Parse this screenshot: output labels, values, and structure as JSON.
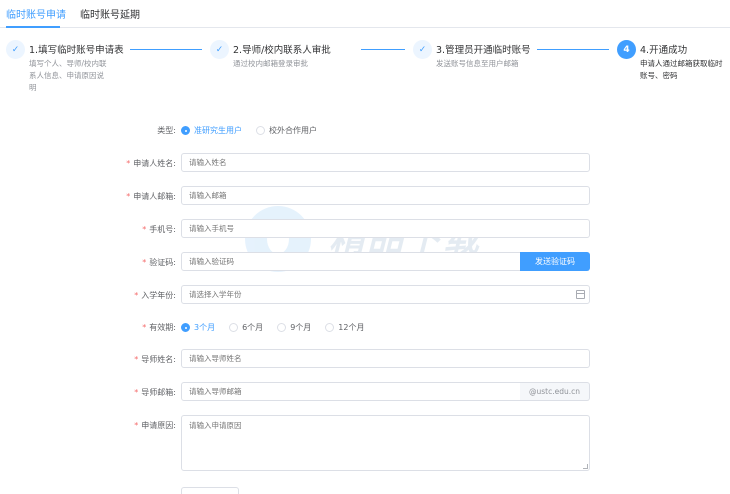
{
  "tabs": [
    {
      "label": "临时账号申请",
      "active": true
    },
    {
      "label": "临时账号延期",
      "active": false
    }
  ],
  "steps": [
    {
      "index": "1",
      "status": "done",
      "title": "1.填写临时账号申请表",
      "desc": "填写个人、导师/校内联系人信息、申请原因说明"
    },
    {
      "index": "2",
      "status": "done",
      "title": "2.导师/校内联系人审批",
      "desc": "通过校内邮箱登录审批"
    },
    {
      "index": "3",
      "status": "done",
      "title": "3.管理员开通临时账号",
      "desc": "发送账号信息至用户邮箱"
    },
    {
      "index": "4",
      "status": "active",
      "title": "4.开通成功",
      "desc": "申请人通过邮箱获取临时账号、密码"
    }
  ],
  "step_done_icon": "check-icon",
  "form": {
    "type_label": "类型:",
    "type_options": [
      "准研究生用户",
      "校外合作用户"
    ],
    "type_selected": "准研究生用户",
    "name_label": "申请人姓名:",
    "name_placeholder": "请输入姓名",
    "email_label": "申请人邮箱:",
    "email_placeholder": "请输入邮箱",
    "phone_label": "手机号:",
    "phone_placeholder": "请输入手机号",
    "code_label": "验证码:",
    "code_placeholder": "请输入验证码",
    "send_code_label": "发送验证码",
    "year_label": "入学年份:",
    "year_placeholder": "请选择入学年份",
    "validity_label": "有效期:",
    "validity_options": [
      "3个月",
      "6个月",
      "9个月",
      "12个月"
    ],
    "validity_selected": "3个月",
    "advisor_name_label": "导师姓名:",
    "advisor_name_placeholder": "请输入导师姓名",
    "advisor_email_label": "导师邮箱:",
    "advisor_email_placeholder": "请输入导师邮箱",
    "advisor_email_suffix": "@ustc.edu.cn",
    "reason_label": "申请原因:",
    "reason_placeholder": "请输入申请原因"
  },
  "watermark": {
    "text": "精品下载",
    "url": "www.jb.com"
  },
  "colors": {
    "primary": "#409eff",
    "required": "#f56c6c",
    "border": "#dcdfe6"
  }
}
